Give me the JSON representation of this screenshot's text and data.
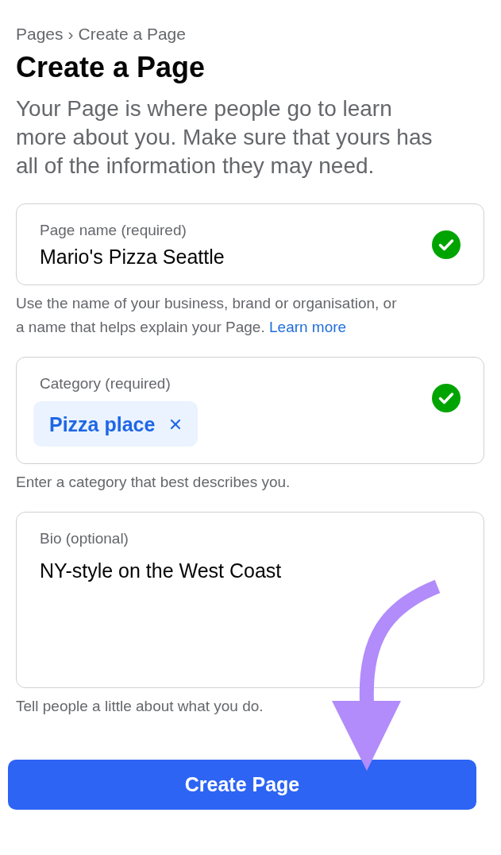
{
  "breadcrumb": {
    "items": [
      "Pages",
      "Create a Page"
    ],
    "separator": "›"
  },
  "title": "Create a Page",
  "description": "Your Page is where people go to learn more about you. Make sure that yours has all of the information they may need.",
  "fields": [
    {
      "kind": "text",
      "label": "Page name (required)",
      "value": "Mario's Pizza Seattle",
      "valid": true,
      "help": "Use the name of your business, brand or organisation, or a name that helps explain your Page.",
      "help_link": "Learn more"
    },
    {
      "kind": "tags",
      "label": "Category (required)",
      "tags": [
        "Pizza place"
      ],
      "valid": true,
      "help": "Enter a category that best describes you."
    },
    {
      "kind": "textarea",
      "label": "Bio (optional)",
      "value": "NY-style on the West Coast",
      "help": "Tell people a little about what you do."
    }
  ],
  "submit_button": "Create Page"
}
